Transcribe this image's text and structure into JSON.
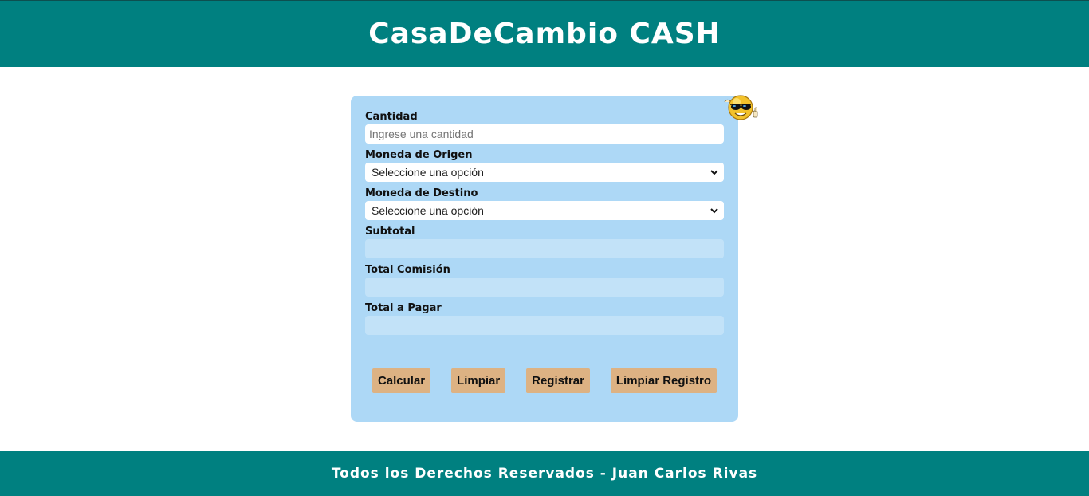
{
  "header": {
    "title": "CasaDeCambio CASH"
  },
  "form": {
    "cantidad": {
      "label": "Cantidad",
      "placeholder": "Ingrese una cantidad",
      "value": ""
    },
    "moneda_origen": {
      "label": "Moneda de Origen",
      "selected": "Seleccione una opción"
    },
    "moneda_destino": {
      "label": "Moneda de Destino",
      "selected": "Seleccione una opción"
    },
    "subtotal": {
      "label": "Subtotal",
      "value": ""
    },
    "total_comision": {
      "label": "Total Comisión",
      "value": ""
    },
    "total_pagar": {
      "label": "Total a Pagar",
      "value": ""
    }
  },
  "buttons": {
    "calcular": "Calcular",
    "limpiar": "Limpiar",
    "registrar": "Registrar",
    "limpiar_registro": "Limpiar Registro"
  },
  "emoji": {
    "icon": "cool-sunglasses-smiley-icon"
  },
  "footer": {
    "text": "Todos los Derechos Reservados - Juan Carlos Rivas"
  },
  "colors": {
    "header_bg": "#008080",
    "card_bg": "#add8f6",
    "button_bg": "#ddb283"
  }
}
